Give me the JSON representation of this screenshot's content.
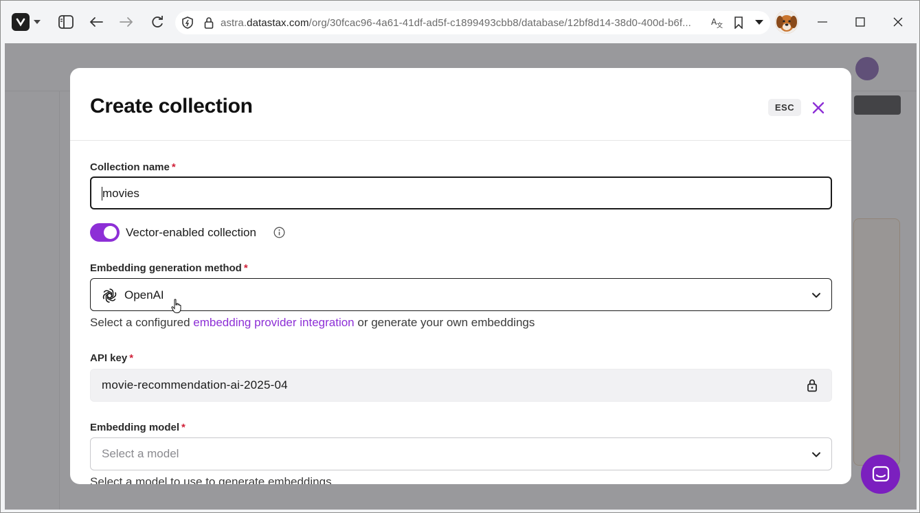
{
  "browser": {
    "url_prefix": "astra.",
    "url_host": "datastax.com",
    "url_path": "/org/30fcac96-4a61-41df-ad5f-c1899493cbb8/database/12bf8d14-38d0-400d-b6f..."
  },
  "modal": {
    "title": "Create collection",
    "esc_label": "ESC",
    "collection_name": {
      "label": "Collection name",
      "required_mark": "*",
      "value": "movies"
    },
    "vector_toggle": {
      "label": "Vector-enabled collection",
      "enabled": true
    },
    "embedding_method": {
      "label": "Embedding generation method",
      "required_mark": "*",
      "value": "OpenAI",
      "help_prefix": "Select a configured ",
      "help_link": "embedding provider integration",
      "help_suffix": " or generate your own embeddings"
    },
    "api_key": {
      "label": "API key",
      "required_mark": "*",
      "value": "movie-recommendation-ai-2025-04"
    },
    "embedding_model": {
      "label": "Embedding model",
      "required_mark": "*",
      "placeholder": "Select a model",
      "help": "Select a model to use to generate embeddings"
    }
  },
  "colors": {
    "accent": "#8d2fd6",
    "required": "#d0223a",
    "chat": "#7b1fbf"
  }
}
